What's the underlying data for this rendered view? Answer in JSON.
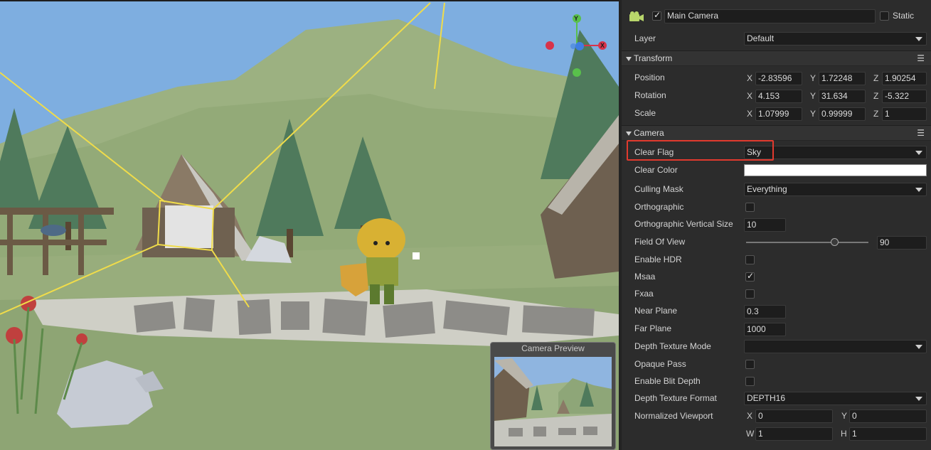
{
  "scene": {
    "preview_title": "Camera Preview",
    "gizmo": {
      "y_label": "Y",
      "x_label": "X"
    },
    "colors": {
      "sky": "#7eaee0",
      "grass": "#90a872",
      "frustum": "#f0dc4a"
    }
  },
  "inspector": {
    "header": {
      "icon": "camera-icon",
      "enabled": true,
      "name": "Main Camera",
      "static_label": "Static",
      "static_checked": false
    },
    "layer": {
      "label": "Layer",
      "value": "Default"
    },
    "transform": {
      "title": "Transform",
      "position": {
        "label": "Position",
        "x": "-2.83596",
        "y": "1.72248",
        "z": "1.90254"
      },
      "rotation": {
        "label": "Rotation",
        "x": "4.153",
        "y": "31.634",
        "z": "-5.322"
      },
      "scale": {
        "label": "Scale",
        "x": "1.07999",
        "y": "0.99999",
        "z": "1"
      }
    },
    "camera": {
      "title": "Camera",
      "clear_flag": {
        "label": "Clear Flag",
        "value": "Sky"
      },
      "clear_color": {
        "label": "Clear Color",
        "value": "#ffffff"
      },
      "culling_mask": {
        "label": "Culling Mask",
        "value": "Everything"
      },
      "orthographic": {
        "label": "Orthographic",
        "checked": false
      },
      "ortho_size": {
        "label": "Orthographic Vertical Size",
        "value": "10"
      },
      "fov": {
        "label": "Field Of View",
        "value": "90",
        "fraction": 0.69
      },
      "hdr": {
        "label": "Enable HDR",
        "checked": false
      },
      "msaa": {
        "label": "Msaa",
        "checked": true
      },
      "fxaa": {
        "label": "Fxaa",
        "checked": false
      },
      "near": {
        "label": "Near Plane",
        "value": "0.3"
      },
      "far": {
        "label": "Far Plane",
        "value": "1000"
      },
      "depth_mode": {
        "label": "Depth Texture Mode",
        "value": ""
      },
      "opaque_pass": {
        "label": "Opaque Pass",
        "checked": false
      },
      "blit_depth": {
        "label": "Enable Blit Depth",
        "checked": false
      },
      "depth_format": {
        "label": "Depth Texture Format",
        "value": "DEPTH16"
      },
      "viewport": {
        "label": "Normalized Viewport",
        "x": "0",
        "y": "0",
        "w": "1",
        "h": "1"
      }
    },
    "axis_labels": {
      "x": "X",
      "y": "Y",
      "z": "Z",
      "w": "W",
      "h": "H"
    },
    "highlight_color": "#e13a2e"
  }
}
